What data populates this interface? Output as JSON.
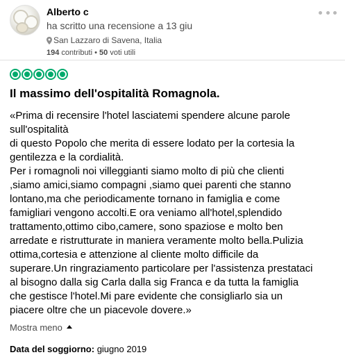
{
  "reviewer": {
    "name": "Alberto c",
    "wrote_line": "ha scritto una recensione a 13 giu",
    "location": "San Lazzaro di Savena, Italia",
    "contributions_count": "194",
    "contributions_label": "contributi",
    "separator": "•",
    "helpful_votes_count": "50",
    "helpful_votes_label": "voti utili",
    "avatar_icon": "avatar-photo-dishes",
    "location_icon": "pin-icon"
  },
  "menu": {
    "more_icon": "more-options-icon"
  },
  "review": {
    "rating": 5,
    "rating_max": 5,
    "rating_color": "#00aa6c",
    "title": "Il massimo dell'ospitalità Romagnola.",
    "body": "«Prima di recensire l'hotel lasciatemi spendere alcune parole\nsull'ospitalità\ndi questo Popolo che merita di essere lodato per la cortesia la\ngentilezza e la cordialità.\nPer i romagnoli noi villeggianti siamo molto di più che clienti\n,siamo amici,siamo compagni ,siamo quei parenti che stanno\nlontano,ma che periodicamente tornano in famiglia e come\nfamigliari vengono accolti.E ora veniamo all'hotel,splendido\ntrattamento,ottimo cibo,camere, sono spaziose e molto ben\narredate e ristrutturate in maniera veramente molto bella.Pulizia\nottima,cortesia e attenzione al cliente molto difficile da\nsuperare.Un ringraziamento particolare per l'assistenza prestataci\nal bisogno dalla sig Carla dalla sig Franca e da tutta la famiglia\nche gestisce l'hotel.Mi pare evidente che consigliarlo sia un\npiacere oltre che un piacevole dovere.»",
    "toggle_label": "Mostra meno",
    "toggle_icon": "caret-up-icon",
    "stay_label": "Data del soggiorno:",
    "stay_value": "giugno 2019"
  }
}
